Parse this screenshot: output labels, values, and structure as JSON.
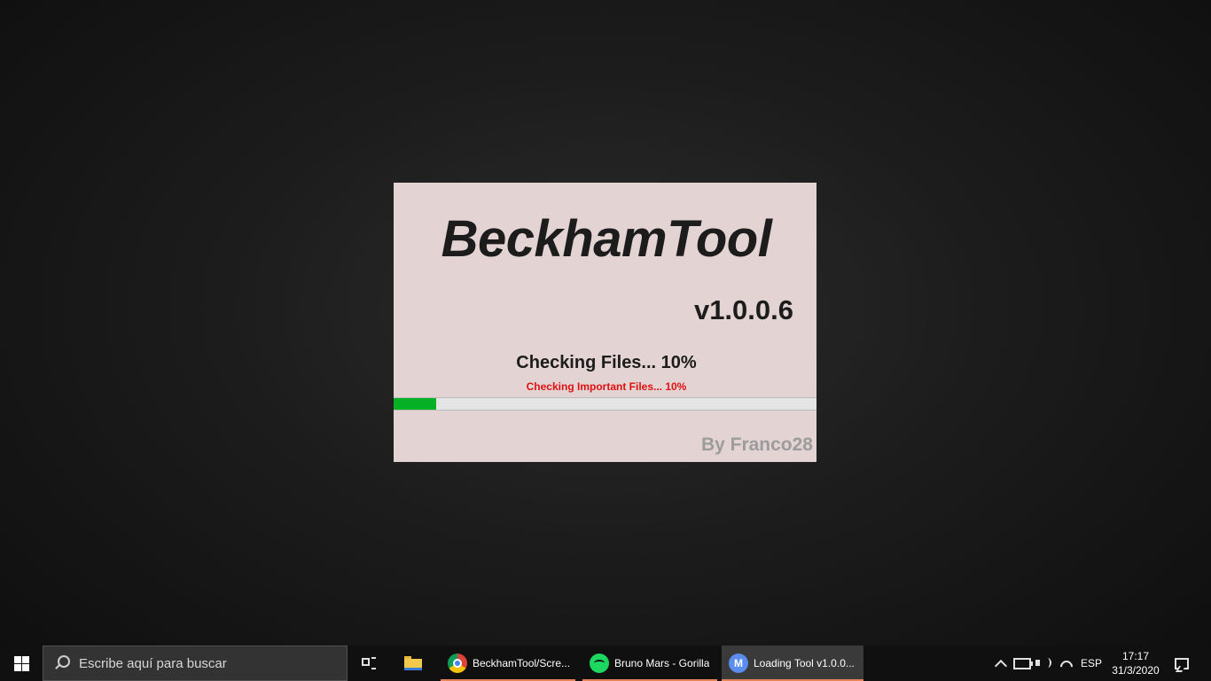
{
  "splash": {
    "title": "BeckhamTool",
    "version": "v1.0.0.6",
    "status": "Checking Files... 10%",
    "substatus": "Checking Important Files... 10%",
    "progress_percent": 10,
    "author": "By Franco28"
  },
  "taskbar": {
    "search_placeholder": "Escribe aquí para buscar",
    "apps": [
      {
        "label": "BeckhamTool/Scre...",
        "icon": "chrome-icon"
      },
      {
        "label": "Bruno Mars - Gorilla",
        "icon": "spotify-icon"
      },
      {
        "label": "Loading Tool v1.0.0...",
        "icon": "motorola-icon",
        "moto_glyph": "M"
      }
    ],
    "tray": {
      "language": "ESP",
      "time": "17:17",
      "date": "31/3/2020"
    }
  },
  "colors": {
    "splash_bg": "#e4d3d3",
    "progress_fill": "#06b025",
    "substatus_text": "#e01010",
    "author_text": "#9c9c9c"
  }
}
